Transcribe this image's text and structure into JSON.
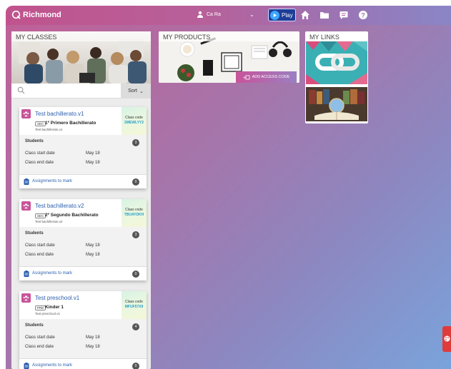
{
  "topbar": {
    "brand": "Richmond",
    "user_name": "Ca Ra",
    "play_label": "Play",
    "icons": [
      "home-icon",
      "folder-icon",
      "chat-icon",
      "help-icon"
    ]
  },
  "my_classes": {
    "title": "MY CLASSES",
    "search_placeholder": "",
    "sort_label": "Sort",
    "cards": [
      {
        "name": "Test bachillerato.v1",
        "level_tag": "SEC",
        "level_name": "1º Primero Bachillerato",
        "subtitle": "Test bachillerato.v1",
        "code_label": "Class code",
        "code": "2MEWLYY2",
        "students_label": "Students",
        "students_count": "3",
        "start_label": "Class start date",
        "start_value": "May 18",
        "end_label": "Class end date",
        "end_value": "May 18",
        "assign_label": "Assignments to mark",
        "assign_count": "0"
      },
      {
        "name": "Test bachillerato.v2",
        "level_tag": "SEC",
        "level_name": "2º Segundo Bachillerato",
        "subtitle": "Test bachillerato.v2",
        "code_label": "Class code",
        "code": "TBUAYDKH",
        "students_label": "Students",
        "students_count": "3",
        "start_label": "Class start date",
        "start_value": "May 18",
        "end_label": "Class end date",
        "end_value": "May 18",
        "assign_label": "Assignments to mark",
        "assign_count": "0"
      },
      {
        "name": "Test preschool.v1",
        "level_tag": "PRE",
        "level_name": "Kinder 1",
        "subtitle": "Test preschool.v1",
        "code_label": "Class code",
        "code": "MFUF57X9",
        "students_label": "Students",
        "students_count": "4",
        "start_label": "Class start date",
        "start_value": "May 18",
        "end_label": "Class end date",
        "end_value": "May 18",
        "assign_label": "Assignments to mark",
        "assign_count": "0"
      }
    ]
  },
  "my_products": {
    "title": "MY PRODUCTS",
    "add_code_label": "ADD ACCESS CODE"
  },
  "my_links": {
    "title": "MY LINKS"
  },
  "colors": {
    "brand_pink": "#c8549a",
    "link_blue": "#2b5fae",
    "play_blue": "#1f3d96",
    "code_teal": "#2aa0c9"
  }
}
